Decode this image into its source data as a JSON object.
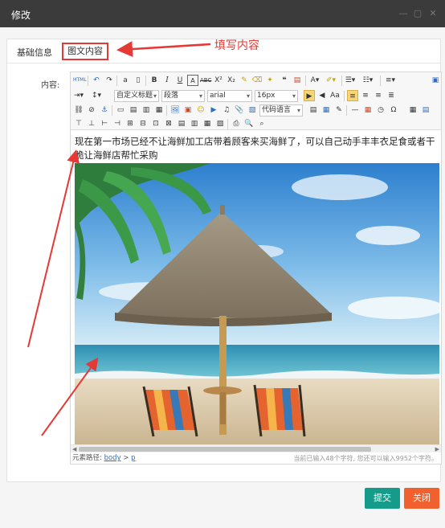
{
  "dialog": {
    "title": "修改",
    "window_controls": [
      "minimize-icon",
      "maximize-icon",
      "close-icon"
    ]
  },
  "tabs": [
    {
      "label": "基础信息",
      "active": false
    },
    {
      "label": "图文内容",
      "active": true
    }
  ],
  "annotation": {
    "text": "填写内容",
    "color": "#e53935"
  },
  "form": {
    "content_label": "内容:"
  },
  "toolbar": {
    "paragraph_format": "自定义标题",
    "paragraph": "段落",
    "font_family": "arial",
    "font_size": "16px",
    "code_language": "代码语言"
  },
  "editor": {
    "text": "现在第一市场已经不让海鲜加工店带着顾客来买海鲜了，可以自己动手丰丰衣足食或者干脆让海鲜店帮忙采购",
    "image_subject": "beach-umbrella-and-chairs"
  },
  "statusbar": {
    "path_label": "元素路径:",
    "path_body": "body",
    "path_sep": ">",
    "path_p": "p",
    "char_count": "当前已输入48个字符, 您还可以输入9952个字符。"
  },
  "buttons": {
    "submit": "提交",
    "close": "关闭"
  },
  "colors": {
    "titlebar": "#3b3b3b",
    "submit": "#159b8a",
    "close": "#f0612f",
    "annotation": "#e53935"
  }
}
